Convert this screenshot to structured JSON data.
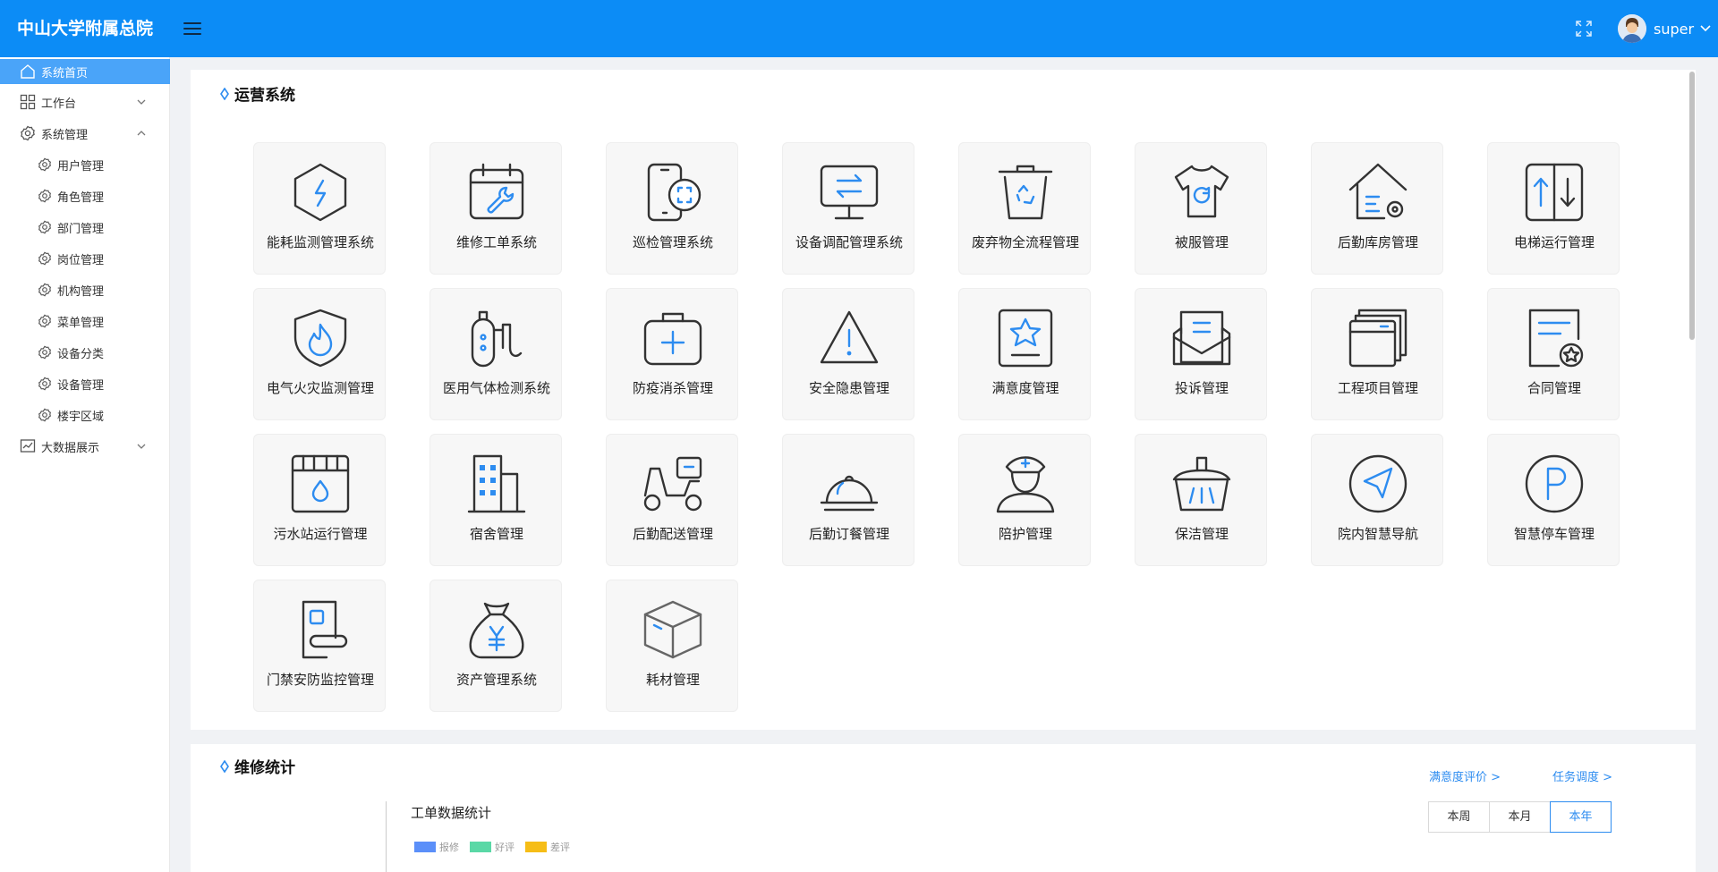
{
  "app": {
    "title": "中山大学附属总院"
  },
  "header": {
    "username": "super"
  },
  "sidebar": {
    "items": [
      {
        "label": "系统首页"
      },
      {
        "label": "工作台"
      },
      {
        "label": "系统管理"
      },
      {
        "label": "用户管理"
      },
      {
        "label": "角色管理"
      },
      {
        "label": "部门管理"
      },
      {
        "label": "岗位管理"
      },
      {
        "label": "机构管理"
      },
      {
        "label": "菜单管理"
      },
      {
        "label": "设备分类"
      },
      {
        "label": "设备管理"
      },
      {
        "label": "楼宇区域"
      },
      {
        "label": "大数据展示"
      }
    ]
  },
  "ops": {
    "title": "运营系统",
    "tiles": [
      {
        "label": "能耗监测管理系统",
        "icon": "energy-icon"
      },
      {
        "label": "维修工单系统",
        "icon": "repair-calendar-icon"
      },
      {
        "label": "巡检管理系统",
        "icon": "phone-scan-icon"
      },
      {
        "label": "设备调配管理系统",
        "icon": "monitor-transfer-icon"
      },
      {
        "label": "废弃物全流程管理",
        "icon": "recycle-bin-icon"
      },
      {
        "label": "被服管理",
        "icon": "tshirt-icon"
      },
      {
        "label": "后勤库房管理",
        "icon": "warehouse-icon"
      },
      {
        "label": "电梯运行管理",
        "icon": "elevator-icon"
      },
      {
        "label": "电气火灾监测管理",
        "icon": "fire-shield-icon"
      },
      {
        "label": "医用气体检测系统",
        "icon": "gas-cylinder-icon"
      },
      {
        "label": "防疫消杀管理",
        "icon": "first-aid-kit-icon"
      },
      {
        "label": "安全隐患管理",
        "icon": "warning-triangle-icon"
      },
      {
        "label": "满意度管理",
        "icon": "star-board-icon"
      },
      {
        "label": "投诉管理",
        "icon": "complaint-mail-icon"
      },
      {
        "label": "工程项目管理",
        "icon": "project-window-icon"
      },
      {
        "label": "合同管理",
        "icon": "contract-icon"
      },
      {
        "label": "污水站运行管理",
        "icon": "sewage-icon"
      },
      {
        "label": "宿舍管理",
        "icon": "building-icon"
      },
      {
        "label": "后勤配送管理",
        "icon": "delivery-scooter-icon"
      },
      {
        "label": "后勤订餐管理",
        "icon": "food-cloche-icon"
      },
      {
        "label": "陪护管理",
        "icon": "nurse-icon"
      },
      {
        "label": "保洁管理",
        "icon": "cleaning-brush-icon"
      },
      {
        "label": "院内智慧导航",
        "icon": "navigation-icon"
      },
      {
        "label": "智慧停车管理",
        "icon": "parking-icon"
      },
      {
        "label": "门禁安防监控管理",
        "icon": "door-lock-icon"
      },
      {
        "label": "资产管理系统",
        "icon": "money-bag-icon"
      },
      {
        "label": "耗材管理",
        "icon": "box-icon"
      }
    ]
  },
  "stats": {
    "title": "维修统计",
    "links": {
      "satisfaction": "满意度评价 >",
      "dispatch": "任务调度 >"
    },
    "periods": [
      "本周",
      "本月",
      "本年"
    ],
    "selected_period": "本年",
    "chart_title": "工单数据统计",
    "legend": [
      {
        "name": "报修",
        "color": "#5b8ff9"
      },
      {
        "name": "好评",
        "color": "#5ad8a6"
      },
      {
        "name": "差评",
        "color": "#f6bd16"
      }
    ]
  },
  "colors": {
    "header": "#0c8cf6",
    "accent": "#2d8cf0",
    "active_nav": "#4aa4f9"
  }
}
